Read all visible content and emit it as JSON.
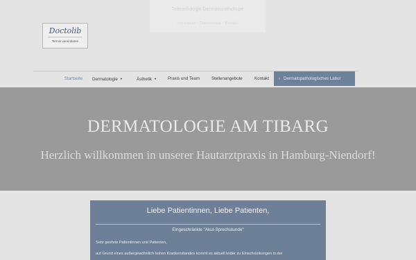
{
  "topbar": {
    "title": "Teleradiologie Dermatopathologie",
    "links": "Impressum  ·  Datenschutz  ·  Kontakt"
  },
  "logo": {
    "brand": "Doctolib",
    "sub": "Termin vereinbaren"
  },
  "nav": {
    "items": [
      {
        "label": "Startseite"
      },
      {
        "label": "Dermatologie"
      },
      {
        "label": "Ästhetik"
      },
      {
        "label": "Praxis und Team"
      },
      {
        "label": "Stellenangebote"
      },
      {
        "label": "Kontakt"
      }
    ],
    "cta": "Dermatopathologisches Labor"
  },
  "hero": {
    "title": "DERMATOLOGIE AM TIBARG",
    "subtitle": "Herzlich willkommen in unserer Hautarztpraxis in Hamburg-Niendorf!"
  },
  "notice": {
    "heading": "Liebe Patientinnen, Liebe Patienten,",
    "subheading": "Eingeschränkte \"Akut-Sprechstunde\"",
    "para1": "Sehr geehrte Patientinnen und Patienten,",
    "para2": "auf Grund eines außergewöhnlich hohen Krankenstandes kommt es aktuell leider zu Einschränkungen in der"
  },
  "colors": {
    "accent": "#6c819a",
    "active_nav": "#6d87a3",
    "hero_bg": "#9a9a9a"
  }
}
